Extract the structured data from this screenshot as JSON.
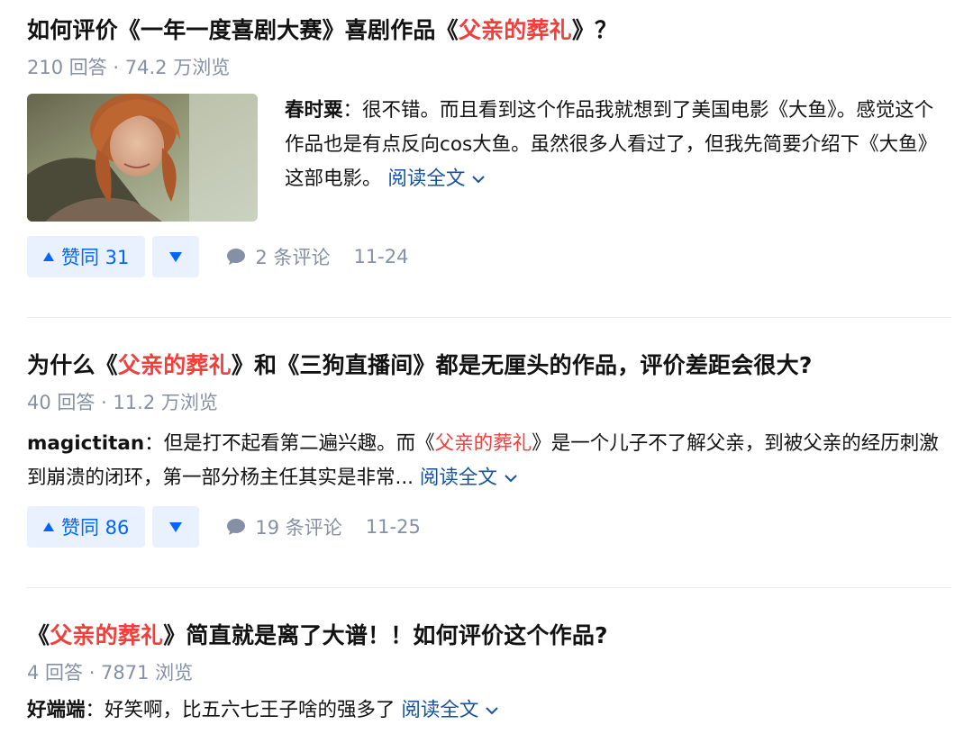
{
  "items": [
    {
      "title": {
        "pre": "如何评价《一年一度喜剧大赛》喜剧作品《",
        "hl": "父亲的葬礼",
        "post": "》？"
      },
      "meta": "210 回答 · 74.2 万浏览",
      "excerpt": {
        "author": "春时粟",
        "text_a": "：很不错。而且看到这个作品我就想到了美国电影《大鱼》。感觉这个作品也是有点反向cos大鱼。虽然很多人看过了，但我先简要介绍下《大鱼》这部电影。"
      },
      "read_more": "阅读全文",
      "vote_label": "赞同 31",
      "comments": "2 条评论",
      "date": "11-24"
    },
    {
      "title": {
        "pre": "为什么《",
        "hl": "父亲的葬礼",
        "post": "》和《三狗直播间》都是无厘头的作品，评价差距会很大?"
      },
      "meta": "40 回答 · 11.2 万浏览",
      "excerpt": {
        "author": "magictitan",
        "text_a": "：但是打不起看第二遍兴趣。而《",
        "hl": "父亲的葬礼",
        "text_b": "》是一个儿子不了解父亲，到被父亲的经历刺激到崩溃的闭环，第一部分杨主任其实是非常..."
      },
      "read_more": "阅读全文",
      "vote_label": "赞同 86",
      "comments": "19 条评论",
      "date": "11-25"
    },
    {
      "title": {
        "pre": "《",
        "hl": "父亲的葬礼",
        "post": "》简直就是离了大谱！！如何评价这个作品?"
      },
      "meta": "4 回答 · 7871 浏览",
      "excerpt": {
        "author": "好端端",
        "text_a": "：好笑啊，比五六七王子啥的强多了"
      },
      "read_more": "阅读全文"
    }
  ],
  "colors": {
    "highlight": "#f1403c",
    "link": "#175199",
    "vote_bg": "#e8f1fd",
    "vote_text": "#0066ff",
    "meta": "#8590a6"
  },
  "icons": {
    "vote_up": "triangle-up-icon",
    "vote_down": "triangle-down-icon",
    "comment": "speech-bubble-icon",
    "expand": "chevron-down-icon"
  }
}
